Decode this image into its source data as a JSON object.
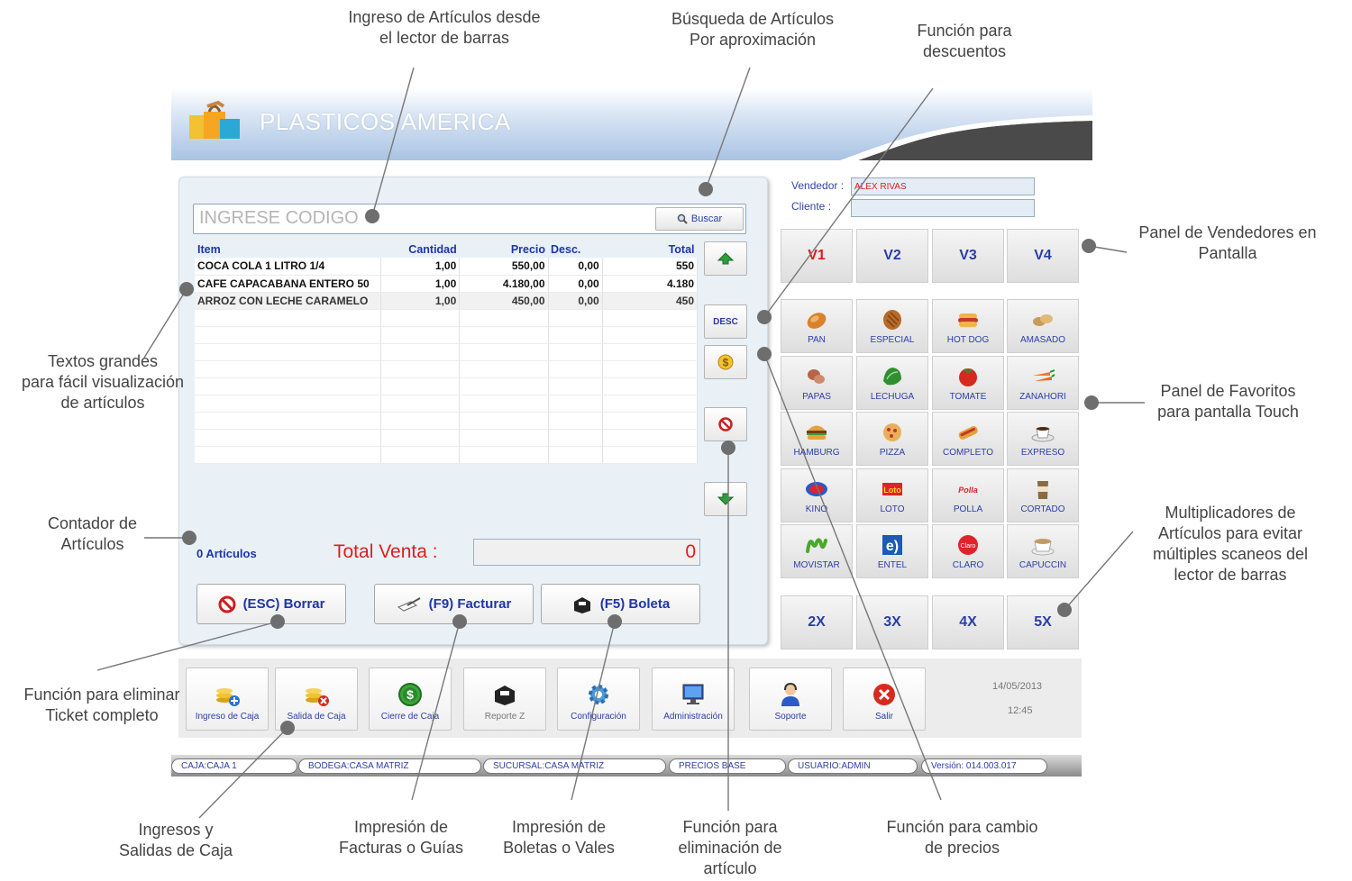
{
  "header": {
    "title": "PLASTICOS AMERICA"
  },
  "search": {
    "placeholder": "INGRESE CODIGO",
    "button_label": "Buscar"
  },
  "table": {
    "columns": [
      "Item",
      "Cantidad",
      "Precio",
      "Desc.",
      "Total"
    ],
    "rows": [
      {
        "item": "COCA COLA 1 LITRO 1/4",
        "cantidad": "1,00",
        "precio": "550,00",
        "desc": "0,00",
        "total": "550"
      },
      {
        "item": "CAFE CAPACABANA ENTERO 50",
        "cantidad": "1,00",
        "precio": "4.180,00",
        "desc": "0,00",
        "total": "4.180"
      },
      {
        "item": "ARROZ CON LECHE CARAMELO",
        "cantidad": "1,00",
        "precio": "450,00",
        "desc": "0,00",
        "total": "450"
      }
    ]
  },
  "side_buttons": {
    "desc_label": "DESC"
  },
  "summary": {
    "count_text": "0 Artículos",
    "total_label": "Total Venta :",
    "total_value": "0"
  },
  "actions": {
    "borrar": "(ESC) Borrar",
    "facturar": "(F9) Facturar",
    "boleta": "(F5) Boleta"
  },
  "vendor_info": {
    "vendedor_label": "Vendedor :",
    "vendedor_value": "ALEX RIVAS",
    "cliente_label": "Cliente :",
    "cliente_value": ""
  },
  "sellers": [
    "V1",
    "V2",
    "V3",
    "V4"
  ],
  "favorites": [
    [
      "PAN",
      "ESPECIAL",
      "HOT DOG",
      "AMASADO"
    ],
    [
      "PAPAS",
      "LECHUGA",
      "TOMATE",
      "ZANAHORI"
    ],
    [
      "HAMBURG",
      "PIZZA",
      "COMPLETO",
      "EXPRESO"
    ],
    [
      "KINO",
      "LOTO",
      "POLLA",
      "CORTADO"
    ],
    [
      "MOVISTAR",
      "ENTEL",
      "CLARO",
      "CAPUCCIN"
    ]
  ],
  "favorite_logo_text": {
    "loto": "Loto",
    "polla": "Polla",
    "claro": "Claro",
    "entel": "e)"
  },
  "multipliers": [
    "2X",
    "3X",
    "4X",
    "5X"
  ],
  "toolbar": {
    "ingreso": "Ingreso de Caja",
    "salida": "Salida de Caja",
    "cierre": "Cierre de Caja",
    "reporte": "Reporte Z",
    "config": "Configuración",
    "admin": "Administración",
    "soporte": "Soporte",
    "salir": "Salir",
    "date": "14/05/2013",
    "time": "12:45"
  },
  "status": {
    "caja": "CAJA:CAJA 1",
    "bodega": "BODEGA:CASA MATRIZ",
    "sucursal": "SUCURSAL:CASA MATRIZ",
    "precios": "PRECIOS BASE",
    "usuario": "USUARIO:ADMIN",
    "version": "Versión: 014.003.017"
  },
  "callouts": {
    "ingreso_lector": "Ingreso de Artículos desde\nel lector de barras",
    "busqueda": "Búsqueda de Artículos\nPor aproximación",
    "descuentos": "Función para\ndescuentos",
    "vendedores": "Panel de Vendedores en\nPantalla",
    "textos": "Textos grandes\npara fácil visualización\nde artículos",
    "favoritos": "Panel de Favoritos\npara pantalla Touch",
    "contador": "Contador de\nArtículos",
    "multiplicadores": "Multiplicadores de\nArtículos para evitar\nmúltiples scaneos del\nlector de barras",
    "eliminar_ticket": "Función para eliminar\nTicket completo",
    "ingresos_salidas": "Ingresos y\nSalidas de Caja",
    "facturas": "Impresión de\nFacturas o Guías",
    "boletas": "Impresión de\nBoletas o Vales",
    "eliminacion": "Función para\neliminación de\nartículo",
    "cambio_precios": "Función para cambio\nde precios"
  }
}
